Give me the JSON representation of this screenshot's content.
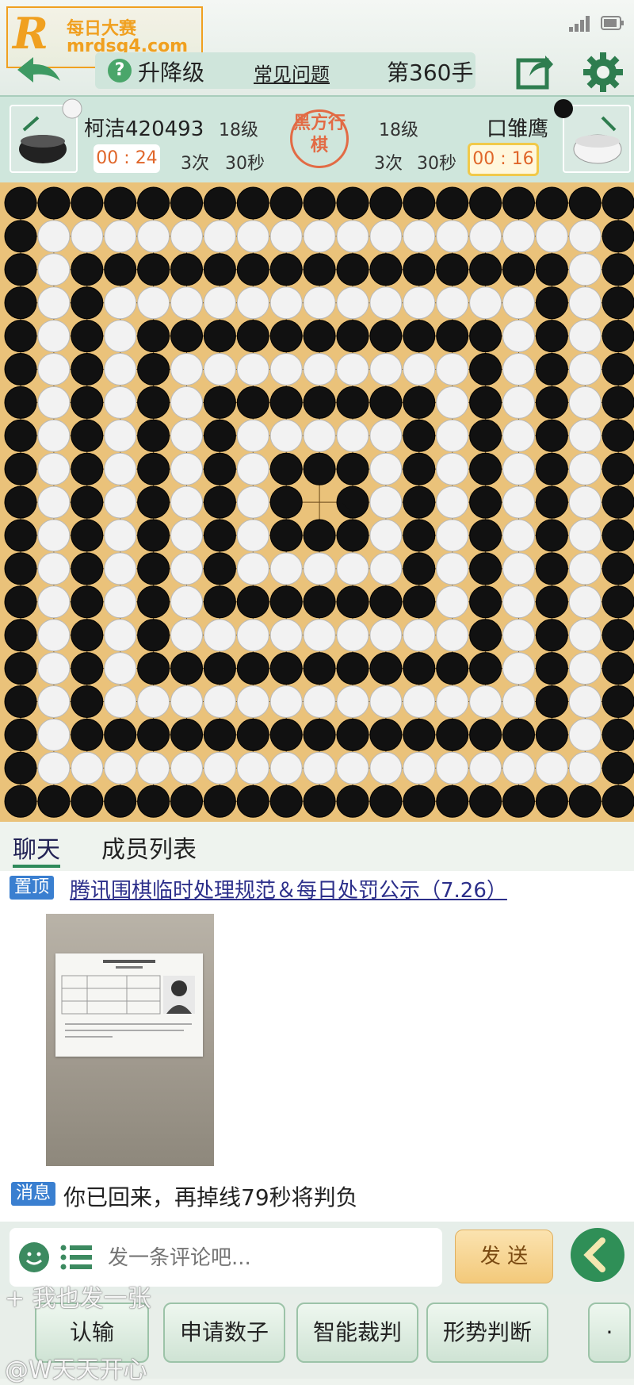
{
  "watermark": {
    "logo_letter": "R",
    "title": "每日大赛",
    "url": "mrdsg4.com"
  },
  "header": {
    "level_label": "升降级",
    "faq_label": "常见问题",
    "move_count": "第360手"
  },
  "players": {
    "left": {
      "name": "柯洁420493",
      "level": "18级",
      "timer": "00 : 24",
      "tries": "3次",
      "seconds": "30秒"
    },
    "right": {
      "name": "口雏鹰",
      "level": "18级",
      "timer": "00 : 16",
      "tries": "3次",
      "seconds": "30秒"
    },
    "turn_seal": "黑方行棋"
  },
  "board": {
    "size": "19x19",
    "colors": {
      "black": "#111111",
      "white": "#f2f2f2",
      "wood": "#eac27a"
    }
  },
  "tabs": [
    {
      "label": "聊天",
      "active": true
    },
    {
      "label": "成员列表",
      "active": false
    }
  ],
  "chat": {
    "pinned_badge": "置顶",
    "pinned_text": "腾讯围棋临时处理规范＆每日处罚公示（7.26）",
    "message_badge": "消息",
    "message_text": "你已回来，再掉线79秒将判负"
  },
  "input": {
    "placeholder": "发一条评论吧...",
    "send_label": "发 送"
  },
  "bottom_buttons": [
    "认输",
    "申请数子",
    "智能裁判",
    "形势判断"
  ],
  "overlay": {
    "comment": "+  我也发一张",
    "user": "@W天天开心"
  }
}
